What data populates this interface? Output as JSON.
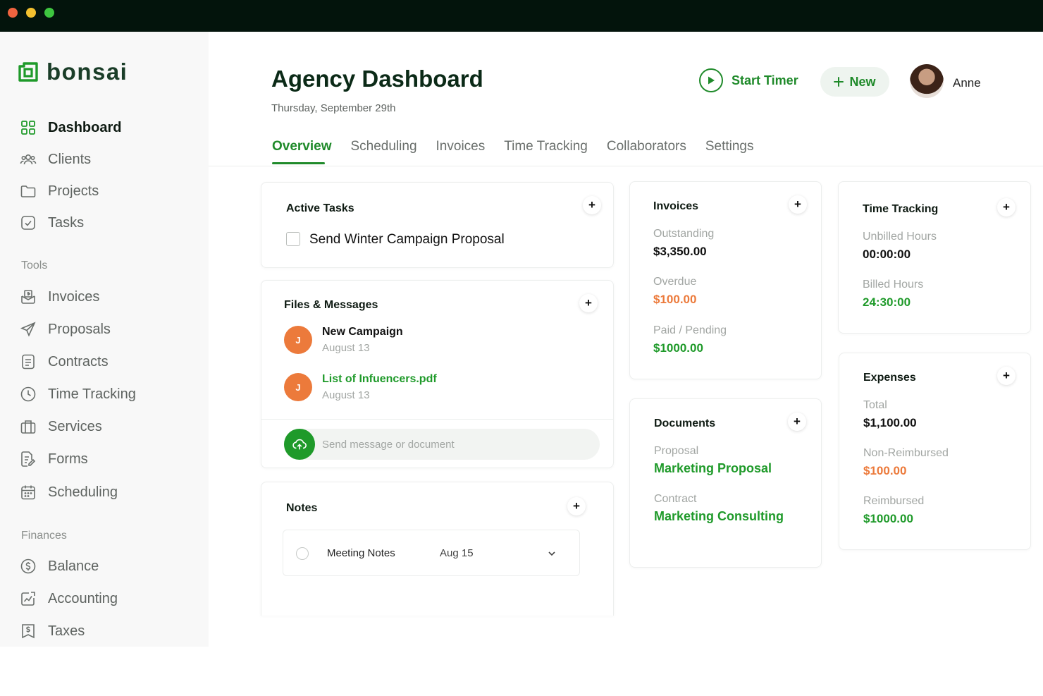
{
  "brand": {
    "name": "bonsai"
  },
  "sidebar": {
    "items": [
      {
        "label": "Dashboard"
      },
      {
        "label": "Clients"
      },
      {
        "label": "Projects"
      },
      {
        "label": "Tasks"
      }
    ],
    "tools_label": "Tools",
    "tools": [
      {
        "label": "Invoices"
      },
      {
        "label": "Proposals"
      },
      {
        "label": "Contracts"
      },
      {
        "label": "Time Tracking"
      },
      {
        "label": "Services"
      },
      {
        "label": "Forms"
      },
      {
        "label": "Scheduling"
      }
    ],
    "finances_label": "Finances",
    "finances": [
      {
        "label": "Balance"
      },
      {
        "label": "Accounting"
      },
      {
        "label": "Taxes"
      }
    ]
  },
  "header": {
    "title": "Agency Dashboard",
    "date": "Thursday, September 29th",
    "start_timer": "Start Timer",
    "new_label": "New",
    "user_name": "Anne"
  },
  "tabs": [
    {
      "label": "Overview"
    },
    {
      "label": "Scheduling"
    },
    {
      "label": "Invoices"
    },
    {
      "label": "Time Tracking"
    },
    {
      "label": "Collaborators"
    },
    {
      "label": "Settings"
    }
  ],
  "active_tasks": {
    "title": "Active Tasks",
    "tasks": [
      {
        "label": "Send Winter Campaign Proposal"
      }
    ]
  },
  "files": {
    "title": "Files & Messages",
    "items": [
      {
        "initial": "J",
        "title": "New Campaign",
        "date": "August 13"
      },
      {
        "initial": "J",
        "title": "List of Infuencers.pdf",
        "date": "August 13"
      }
    ],
    "message_placeholder": "Send message or document"
  },
  "notes": {
    "title": "Notes",
    "items": [
      {
        "title": "Meeting Notes",
        "date": "Aug 15"
      }
    ]
  },
  "invoices": {
    "title": "Invoices",
    "outstanding_label": "Outstanding",
    "outstanding_value": "$3,350.00",
    "overdue_label": "Overdue",
    "overdue_value": "$100.00",
    "paid_label": "Paid / Pending",
    "paid_value": "$1000.00"
  },
  "documents": {
    "title": "Documents",
    "proposal_label": "Proposal",
    "proposal_value": "Marketing Proposal",
    "contract_label": "Contract",
    "contract_value": "Marketing Consulting"
  },
  "time_tracking": {
    "title": "Time Tracking",
    "unbilled_label": "Unbilled Hours",
    "unbilled_value": "00:00:00",
    "billed_label": "Billed Hours",
    "billed_value": "24:30:00"
  },
  "expenses": {
    "title": "Expenses",
    "total_label": "Total",
    "total_value": "$1,100.00",
    "nonreimbursed_label": "Non-Reimbursed",
    "nonreimbursed_value": "$100.00",
    "reimbursed_label": "Reimbursed",
    "reimbursed_value": "$1000.00"
  },
  "colors": {
    "accent": "#1f9a2a",
    "overdue": "#ec7a3b",
    "titlebar": "#03140c"
  }
}
